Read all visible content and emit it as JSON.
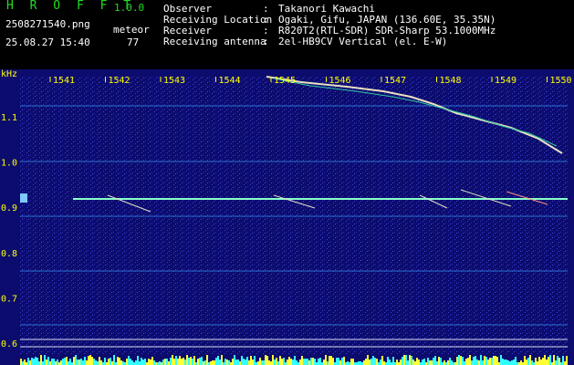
{
  "header": {
    "app_name": "H R O F F T",
    "version": "1.0.0",
    "filename": "2508271540.png",
    "datetime": "25.08.27 15:40",
    "detect_type": "meteor",
    "count": "77",
    "info": [
      {
        "label": "Observer",
        "value": "Takanori Kawachi"
      },
      {
        "label": "Receiving Location",
        "value": "Ogaki, Gifu, JAPAN (136.60E, 35.35N)"
      },
      {
        "label": "Receiver",
        "value": "R820T2(RTL-SDR) SDR-Sharp 53.1000MHz"
      },
      {
        "label": "Receiving antenna",
        "value": "2el-HB9CV Vertical (el. E-W)"
      }
    ],
    "separator": ":"
  },
  "plot": {
    "y_unit": "kHz",
    "y_ticks": [
      "1.1",
      "1.0",
      "0.9",
      "0.8",
      "0.7",
      "0.6"
    ],
    "x_ticks": [
      "1541",
      "1542",
      "1543",
      "1544",
      "1545",
      "1546",
      "1547",
      "1548",
      "1549",
      "1550"
    ],
    "colors": {
      "background": "#0c0c6e",
      "axis_text": "#ffff00",
      "carrier": "#88ffcc",
      "meteor": "#e8e0c0",
      "hline": "#dcdcf0"
    }
  }
}
